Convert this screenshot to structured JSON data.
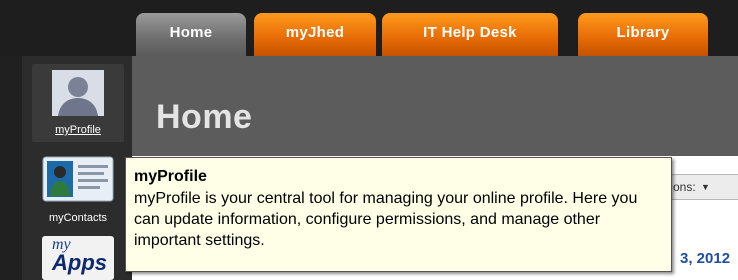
{
  "tabs": [
    {
      "label": "Home",
      "active": true
    },
    {
      "label": "myJhed",
      "active": false
    },
    {
      "label": "IT Help Desk",
      "active": false
    },
    {
      "label": "Library",
      "active": false
    }
  ],
  "sidebar": {
    "items": [
      {
        "label": "myProfile",
        "icon": "profile-silhouette-icon"
      },
      {
        "label": "myContacts",
        "icon": "contact-card-icon"
      },
      {
        "label": "myApps",
        "icon": "apps-logo-icon",
        "logo_text_top": "my",
        "logo_text_bottom": "Apps"
      }
    ]
  },
  "main": {
    "title": "Home",
    "options_label": "ons:",
    "date_text": "3, 2012"
  },
  "tooltip": {
    "title": "myProfile",
    "body": "myProfile is your central tool for managing your online profile. Here you can update information, configure permissions, and manage other important settings."
  },
  "colors": {
    "tab_orange": "#e96e06",
    "tab_active": "#7a7a7a",
    "main_bg": "#5c5c5c",
    "tooltip_bg": "#ffffe8",
    "date_blue": "#1f4fa0"
  }
}
